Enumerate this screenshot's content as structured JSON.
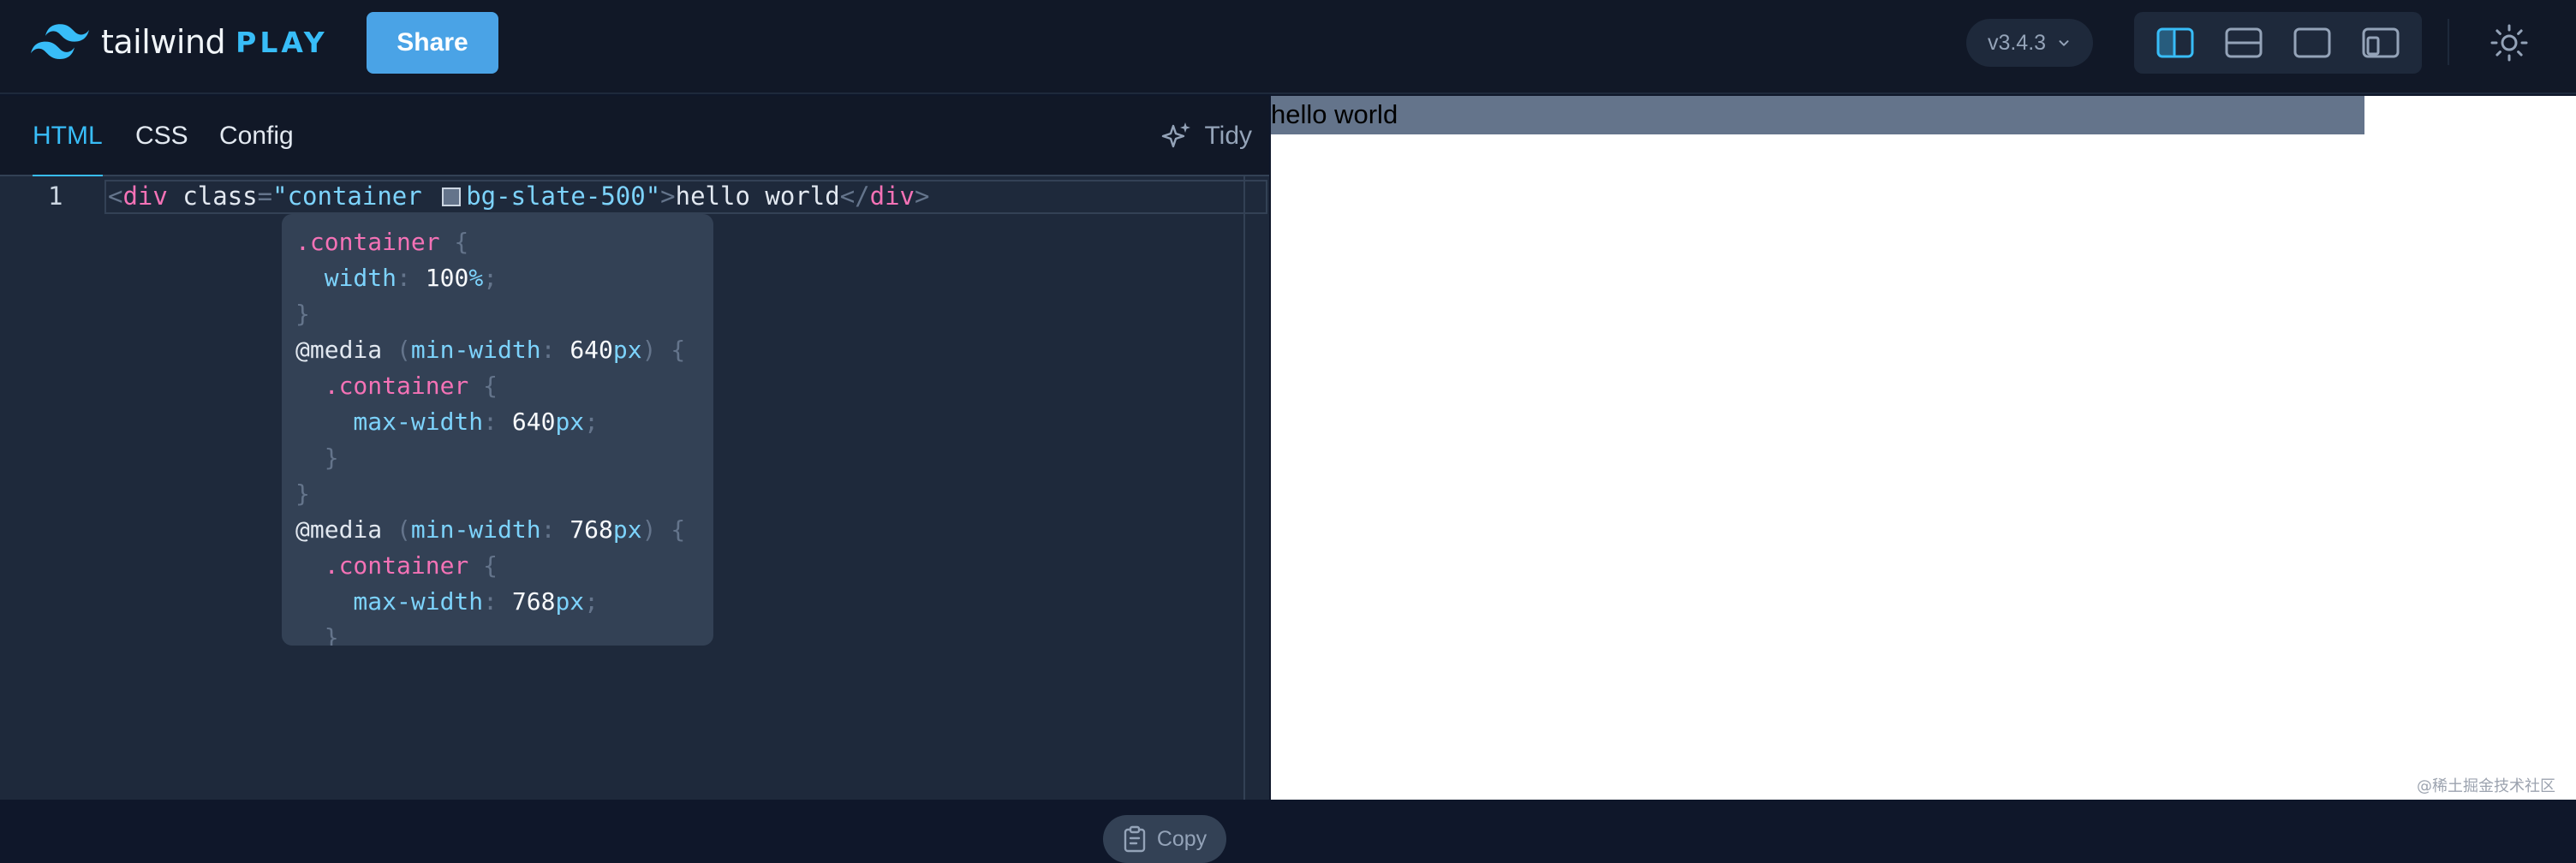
{
  "header": {
    "logo_text": "tailwind",
    "logo_badge": "PLAY",
    "share_label": "Share",
    "version": "v3.4.3",
    "layout_buttons": [
      "split-vertical",
      "split-horizontal",
      "editor-only",
      "preview-responsive"
    ],
    "active_layout": "split-vertical",
    "theme_icon": "sun-icon"
  },
  "editor": {
    "tabs": [
      {
        "label": "HTML",
        "active": true
      },
      {
        "label": "CSS",
        "active": false
      },
      {
        "label": "Config",
        "active": false
      }
    ],
    "tidy_label": "Tidy",
    "line_number": "1",
    "code": {
      "open_lt": "<",
      "tag": "div",
      "attr": "class",
      "eq": "=",
      "quote": "\"",
      "class_a": "container",
      "class_b": "bg-slate-500",
      "close_gt": ">",
      "content": "hello world",
      "end_tag_open": "</",
      "end_tag": "div",
      "end_gt": ">"
    },
    "tooltip_lines": [
      [
        {
          "t": ".container",
          "c": "sel"
        },
        {
          "t": " {",
          "c": "punc"
        }
      ],
      [
        {
          "t": "  width",
          "c": "prop"
        },
        {
          "t": ": ",
          "c": "punc"
        },
        {
          "t": "100",
          "c": "num"
        },
        {
          "t": "%",
          "c": "unit"
        },
        {
          "t": ";",
          "c": "punc"
        }
      ],
      [
        {
          "t": "}",
          "c": "punc"
        }
      ],
      [
        {
          "t": "@media ",
          "c": "at"
        },
        {
          "t": "(",
          "c": "punc"
        },
        {
          "t": "min-width",
          "c": "prop"
        },
        {
          "t": ": ",
          "c": "punc"
        },
        {
          "t": "640",
          "c": "num"
        },
        {
          "t": "px",
          "c": "unit"
        },
        {
          "t": ") {",
          "c": "punc"
        }
      ],
      [
        {
          "t": "  .container",
          "c": "sel"
        },
        {
          "t": " {",
          "c": "punc"
        }
      ],
      [
        {
          "t": "    max-width",
          "c": "prop"
        },
        {
          "t": ": ",
          "c": "punc"
        },
        {
          "t": "640",
          "c": "num"
        },
        {
          "t": "px",
          "c": "unit"
        },
        {
          "t": ";",
          "c": "punc"
        }
      ],
      [
        {
          "t": "  }",
          "c": "punc"
        }
      ],
      [
        {
          "t": "}",
          "c": "punc"
        }
      ],
      [
        {
          "t": "@media ",
          "c": "at"
        },
        {
          "t": "(",
          "c": "punc"
        },
        {
          "t": "min-width",
          "c": "prop"
        },
        {
          "t": ": ",
          "c": "punc"
        },
        {
          "t": "768",
          "c": "num"
        },
        {
          "t": "px",
          "c": "unit"
        },
        {
          "t": ") {",
          "c": "punc"
        }
      ],
      [
        {
          "t": "  .container",
          "c": "sel"
        },
        {
          "t": " {",
          "c": "punc"
        }
      ],
      [
        {
          "t": "    max-width",
          "c": "prop"
        },
        {
          "t": ": ",
          "c": "punc"
        },
        {
          "t": "768",
          "c": "num"
        },
        {
          "t": "px",
          "c": "unit"
        },
        {
          "t": ";",
          "c": "punc"
        }
      ],
      [
        {
          "t": "  }",
          "c": "punc"
        }
      ]
    ],
    "copy_label": "Copy"
  },
  "preview": {
    "text": "hello world",
    "bg_color": "#64748b",
    "watermark": "@稀土掘金技术社区"
  },
  "colors": {
    "accent": "#38bdf8",
    "share_button": "#4aa3e6",
    "header_bg": "#111827",
    "editor_bg": "#1e293b"
  }
}
